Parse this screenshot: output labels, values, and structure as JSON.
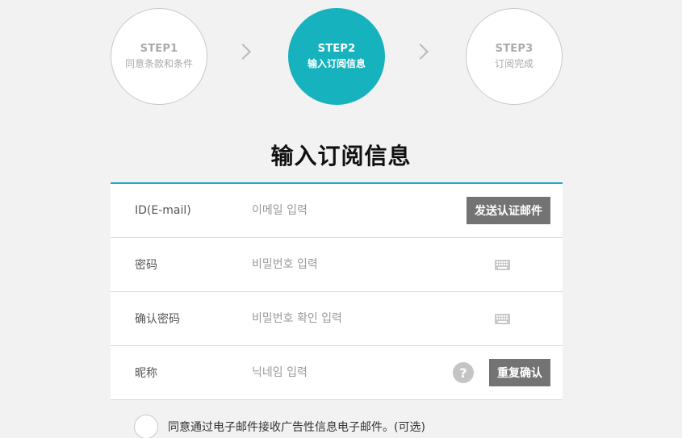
{
  "steps": [
    {
      "num": "STEP1",
      "text": "同意条款和条件",
      "active": false
    },
    {
      "num": "STEP2",
      "text": "输入订阅信息",
      "active": true
    },
    {
      "num": "STEP3",
      "text": "订阅完成",
      "active": false
    }
  ],
  "title": "输入订阅信息",
  "form": {
    "email": {
      "label": "ID(E-mail)",
      "placeholder": "이메일 입력",
      "button": "发送认证邮件"
    },
    "password": {
      "label": "密码",
      "placeholder": "비밀번호 입력"
    },
    "confirm": {
      "label": "确认密码",
      "placeholder": "비밀번호 확인 입력"
    },
    "nickname": {
      "label": "昵称",
      "placeholder": "닉네임 입력",
      "help": "?",
      "button": "重复确认"
    }
  },
  "consent": {
    "text": "同意通过电子邮件接收广告性信息电子邮件。(可选)"
  },
  "colors": {
    "accent": "#16b2be",
    "button": "#737373"
  }
}
